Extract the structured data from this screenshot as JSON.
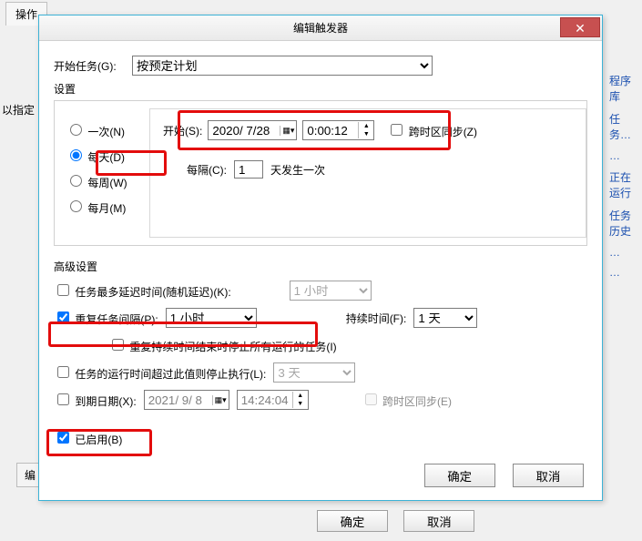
{
  "bg": {
    "oper_tab": "操作",
    "hint": "以指定",
    "side1": "程序库",
    "side2": "任务…",
    "side3": "…",
    "side4": "正在运行",
    "side5": "任务历史",
    "side6": "…",
    "side7": "…",
    "bottom_ok": "确定",
    "bottom_cancel": "取消",
    "edit_btn": "编"
  },
  "dialog": {
    "title": "编辑触发器",
    "close_glyph": "✕",
    "begin_task_label": "开始任务(G):",
    "begin_task_value": "按预定计划",
    "settings_label": "设置",
    "radio_once": "一次(N)",
    "radio_daily": "每天(D)",
    "radio_weekly": "每周(W)",
    "radio_monthly": "每月(M)",
    "start_label": "开始(S):",
    "start_date": "2020/ 7/28",
    "start_time": "0:00:12",
    "sync_tz": "跨时区同步(Z)",
    "every_label": "每隔(C):",
    "every_value": "1",
    "every_suffix": "天发生一次",
    "adv_title": "高级设置",
    "delay_label": "任务最多延迟时间(随机延迟)(K):",
    "delay_value": "1 小时",
    "repeat_label": "重复任务间隔(P):",
    "repeat_value": "1 小时",
    "duration_label": "持续时间(F):",
    "duration_value": "1 天",
    "stop_all_label": "重复持续时间结束时停止所有运行的任务(I)",
    "timeout_label": "任务的运行时间超过此值则停止执行(L):",
    "timeout_value": "3 天",
    "expire_label": "到期日期(X):",
    "expire_date": "2021/ 9/ 8",
    "expire_time": "14:24:04",
    "expire_sync": "跨时区同步(E)",
    "enabled_label": "已启用(B)",
    "ok": "确定",
    "cancel": "取消"
  }
}
